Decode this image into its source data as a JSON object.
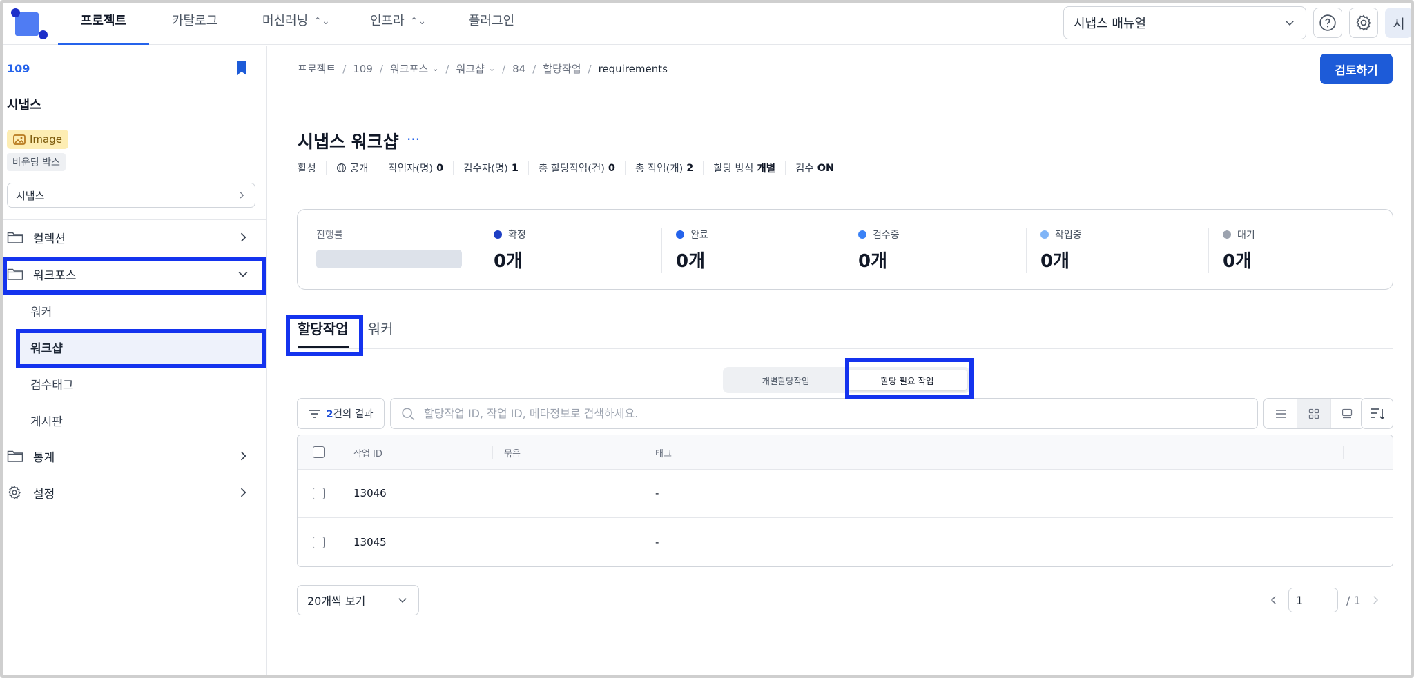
{
  "app": {
    "nav_tabs": [
      {
        "label": "프로젝트",
        "active": true
      },
      {
        "label": "카탈로그"
      },
      {
        "label": "머신러닝"
      },
      {
        "label": "인프라"
      },
      {
        "label": "플러그인"
      }
    ],
    "manual_select": "시냅스 매뉴얼",
    "help_icon": "help-circle-icon",
    "settings_icon": "gear-icon",
    "avatar": "시"
  },
  "sidebar": {
    "project_id": "109",
    "project_name": "시냅스",
    "data_type_badge": "Image",
    "annotation_badge": "바운딩 박스",
    "project_select": "시냅스",
    "items": [
      {
        "label": "컬렉션",
        "icon": "folder-icon"
      },
      {
        "label": "워크포스",
        "icon": "folder-icon",
        "expanded": true
      },
      {
        "label": "워커"
      },
      {
        "label": "워크샵",
        "active": true
      },
      {
        "label": "검수태그"
      },
      {
        "label": "게시판"
      },
      {
        "label": "통계",
        "icon": "folder-icon"
      },
      {
        "label": "설정",
        "icon": "gear-icon"
      }
    ]
  },
  "breadcrumb": [
    "프로젝트",
    "109",
    "워크포스",
    "워크샵",
    "84",
    "할당작업",
    "requirements"
  ],
  "review_button": "검토하기",
  "page": {
    "title": "시냅스 워크샵",
    "more": "···",
    "meta": {
      "status": "활성",
      "visibility": "공개",
      "workers_label": "작업자(명)",
      "workers": "0",
      "reviewers_label": "검수자(명)",
      "reviewers": "1",
      "assignments_label": "총 할당작업(건)",
      "assignments": "0",
      "tasks_label": "총 작업(개)",
      "tasks": "2",
      "assign_method_label": "할당 방식",
      "assign_method": "개별",
      "review_label": "검수",
      "review": "ON"
    }
  },
  "stats": {
    "progress_label": "진행률",
    "progress": 0,
    "items": [
      {
        "label": "확정",
        "value": "0개",
        "color": "#1e3fc4"
      },
      {
        "label": "완료",
        "value": "0개",
        "color": "#2563eb"
      },
      {
        "label": "검수중",
        "value": "0개",
        "color": "#3b82f6"
      },
      {
        "label": "작업중",
        "value": "0개",
        "color": "#7fb4f7"
      },
      {
        "label": "대기",
        "value": "0개",
        "color": "#9ca3af"
      }
    ]
  },
  "tabs": [
    "할당작업",
    "워커"
  ],
  "segments": [
    "개별할당작업",
    "할당 필요 작업"
  ],
  "filter": {
    "count": "2",
    "suffix": "건의 결과"
  },
  "search": {
    "placeholder": "할당작업 ID, 작업 ID, 메타정보로 검색하세요."
  },
  "table": {
    "columns": [
      "작업 ID",
      "묶음",
      "태그"
    ],
    "rows": [
      {
        "id": "13046",
        "bundle": "",
        "tag": "-"
      },
      {
        "id": "13045",
        "bundle": "",
        "tag": "-"
      }
    ]
  },
  "pagination": {
    "page_size": "20개씩 보기",
    "current": "1",
    "total": "/ 1"
  },
  "colors": {
    "accent": "#1d5bd8",
    "highlight": "#1433ee"
  }
}
